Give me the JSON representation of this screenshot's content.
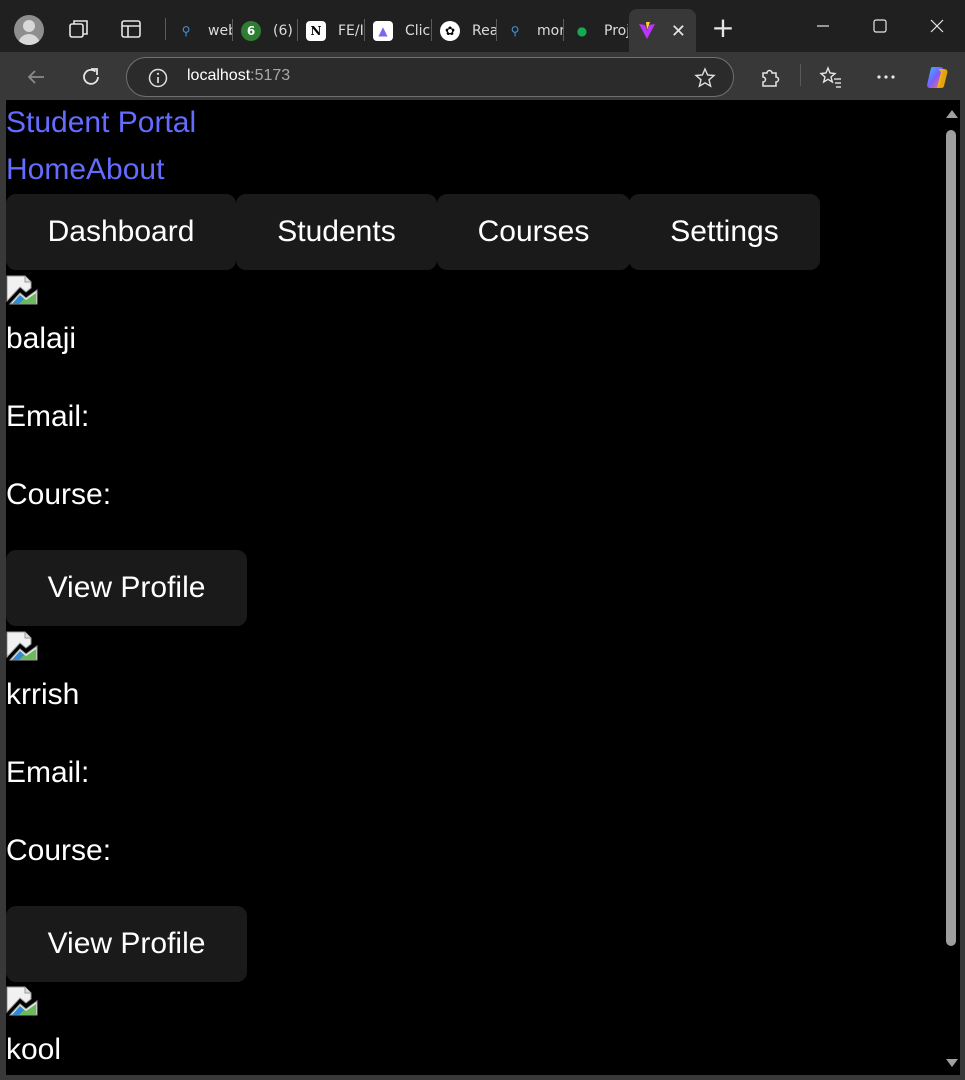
{
  "browser": {
    "tabs": [
      {
        "label": "web",
        "favicon": "search-favicon",
        "color": "#4a90d9"
      },
      {
        "label": "(6) \\",
        "favicon": "badge-favicon",
        "color": "#2e7d32"
      },
      {
        "label": "FE/I",
        "favicon": "notion-favicon",
        "color": "#ffffff"
      },
      {
        "label": "Clic",
        "favicon": "clickup-favicon",
        "color": "#7b68ee"
      },
      {
        "label": "Rea",
        "favicon": "openai-favicon",
        "color": "#ffffff"
      },
      {
        "label": "mor",
        "favicon": "search-favicon",
        "color": "#4a90d9"
      },
      {
        "label": "Proj",
        "favicon": "mongodb-leaf-favicon",
        "color": "#13aa52"
      },
      {
        "label": "",
        "favicon": "vite-favicon",
        "color": "#bd34fe",
        "active": true
      }
    ],
    "url_host": "localhost",
    "url_port": ":5173"
  },
  "page": {
    "brand": "Student Portal",
    "nav": {
      "home": "Home",
      "about": "About"
    },
    "menu": [
      "Dashboard",
      "Students",
      "Courses",
      "Settings"
    ],
    "students": [
      {
        "name": "balaji",
        "email_label": "Email:",
        "course_label": "Course:",
        "button": "View Profile"
      },
      {
        "name": "krrish",
        "email_label": "Email:",
        "course_label": "Course:",
        "button": "View Profile"
      },
      {
        "name": "kool"
      }
    ]
  },
  "colors": {
    "link": "#646cff",
    "page_bg": "#000000",
    "button_bg": "#1a1a1a",
    "chrome_bg": "#202020",
    "toolbar_bg": "#383838"
  }
}
